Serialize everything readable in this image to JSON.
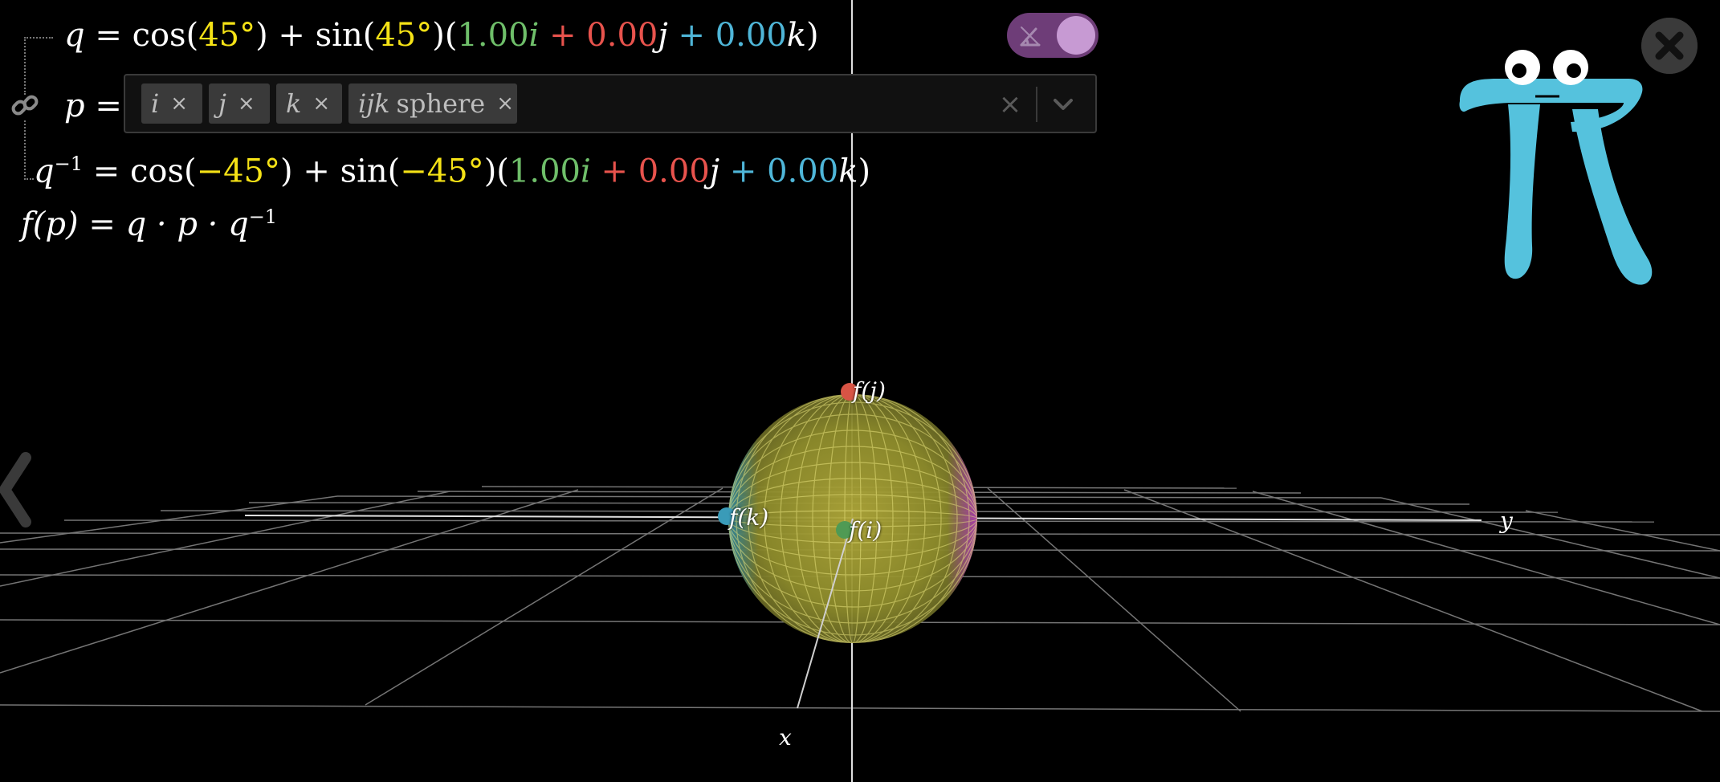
{
  "formulas": {
    "q": {
      "lhs": "q",
      "eq": "=",
      "cos": "cos",
      "sin": "sin",
      "angle": "45°",
      "plus": "+",
      "i_coef": "1.00",
      "j_coef": "0.00",
      "k_coef": "0.00",
      "i": "i",
      "j": "j",
      "k": "k"
    },
    "p": {
      "lhs": "p",
      "eq": "="
    },
    "q_inv": {
      "lhs": "q",
      "sup": "−1",
      "eq": "=",
      "cos": "cos",
      "sin": "sin",
      "angle": "−45°",
      "plus": "+",
      "i_coef": "1.00",
      "j_coef": "0.00",
      "k_coef": "0.00",
      "i": "i",
      "j": "j",
      "k": "k"
    },
    "f": {
      "lhs": "f(p)",
      "eq": "=",
      "rhs": "q · p · q",
      "sup": "−1"
    }
  },
  "selector": {
    "chips": [
      {
        "label": "i",
        "remove": "×"
      },
      {
        "label": "j",
        "remove": "×"
      },
      {
        "label": "k",
        "remove": "×"
      },
      {
        "label": "ijk",
        "label2": "sphere",
        "remove": "×"
      }
    ],
    "clear": "×",
    "dropdown_icon": "chevron-down-icon"
  },
  "icons": {
    "link": "link-icon",
    "toggle": "angle-icon",
    "close": "close-icon",
    "back": "chevron-left-icon",
    "logo": "pi-logo"
  },
  "scene": {
    "labels": {
      "fj": "f(j)",
      "fk": "f(k)",
      "fi": "f(i)",
      "x_axis": "x",
      "y_axis": "y"
    }
  },
  "colors": {
    "yellow": "#f5e216",
    "green": "#6fbf6a",
    "red": "#e8534d",
    "blue": "#4fb6d8",
    "toggle_bg": "#6e3d78",
    "toggle_knob": "#c79ad3",
    "logo": "#55c2dd"
  }
}
